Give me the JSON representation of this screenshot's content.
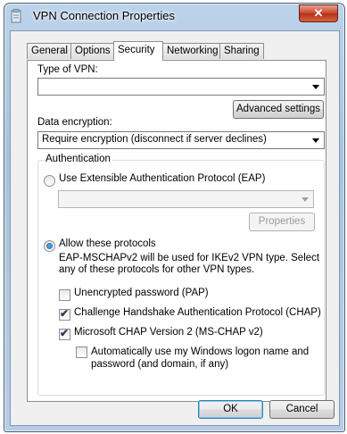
{
  "window": {
    "title": "VPN Connection Properties",
    "close_glyph": "✕"
  },
  "tabs": [
    "General",
    "Options",
    "Security",
    "Networking",
    "Sharing"
  ],
  "security": {
    "vpn_type_label": "Type of VPN:",
    "vpn_type_value": "",
    "advanced_settings": "Advanced settings",
    "encryption_label": "Data encryption:",
    "encryption_value": "Require encryption (disconnect if server declines)",
    "auth_group": "Authentication",
    "eap_option": "Use Extensible Authentication Protocol (EAP)",
    "eap_value": "",
    "properties_button": "Properties",
    "allow_option": "Allow these protocols",
    "allow_desc_line1": "EAP-MSCHAPv2 will be used for IKEv2 VPN type. Select",
    "allow_desc_line2": "any of these protocols for other VPN types.",
    "protocols": [
      {
        "label": "Unencrypted password (PAP)",
        "checked": false
      },
      {
        "label": "Challenge Handshake Authentication Protocol (CHAP)",
        "checked": true
      },
      {
        "label": "Microsoft CHAP Version 2 (MS-CHAP v2)",
        "checked": true
      }
    ],
    "auto_logon_line1": "Automatically use my Windows logon name and",
    "auto_logon_line2": "password (and domain, if any)",
    "auto_logon_checked": false
  },
  "footer": {
    "ok": "OK",
    "cancel": "Cancel"
  },
  "check_glyph": "✔"
}
